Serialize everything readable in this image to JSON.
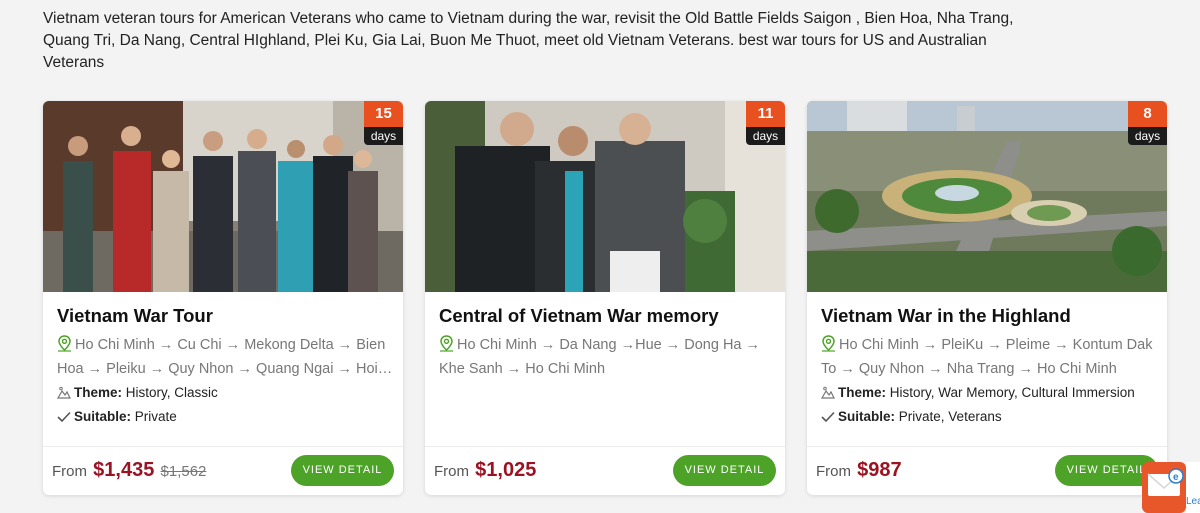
{
  "intro": "Vietnam veteran tours for American Veterans who came to Vietnam during the war, revisit the Old Battle Fields Saigon , Bien Hoa, Nha Trang, Quang Tri, Da Nang, Central HIghland, Plei Ku, Gia Lai, Buon Me Thuot, meet old Vietnam Veterans. best war tours for US and Australian Veterans",
  "labels": {
    "theme_key": "Theme:",
    "suitable_key": "Suitable:",
    "from": "From",
    "view_detail": "VIEW DETAIL",
    "days": "days"
  },
  "tours": [
    {
      "days": "15",
      "title": "Vietnam War Tour",
      "route": "Ho Chi Minh → Cu Chi → Mekong Delta → Bien Hoa → Pleiku → Quy Nhon → Quang Ngai → Hoi An → Da Nang → Hue",
      "theme": "History, Classic",
      "suitable": "Private",
      "price": "$1,435",
      "old_price": "$1,562"
    },
    {
      "days": "11",
      "title": "Central of Vietnam War memory",
      "route": "Ho Chi Minh → Da Nang →Hue → Dong Ha → Khe Sanh → Ho Chi Minh",
      "price": "$1,025"
    },
    {
      "days": "8",
      "title": "Vietnam War in the Highland",
      "route": "Ho Chi Minh → PleiKu → Pleime → Kontum Dak To → Quy Nhon → Nha Trang → Ho Chi Minh",
      "theme": "History, War Memory, Cultural Immersion",
      "suitable": "Private, Veterans",
      "price": "$987"
    }
  ],
  "chat_widget": {
    "icon": "mail-envelope-icon",
    "label": "Lea"
  },
  "colors": {
    "badge": "#e9501f",
    "price": "#9b1222",
    "button": "#4da327",
    "icon_green": "#4da327"
  }
}
